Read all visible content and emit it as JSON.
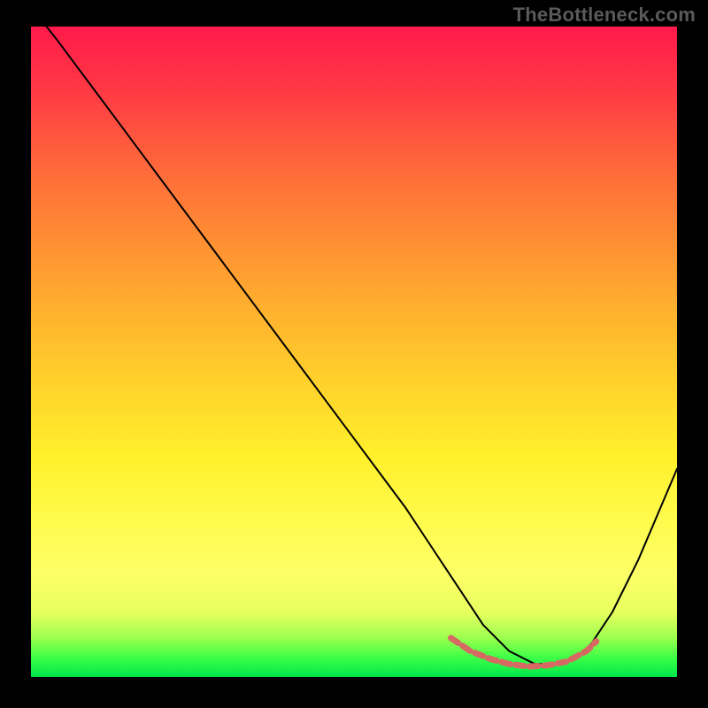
{
  "watermark": "TheBottleneck.com",
  "chart_data": {
    "type": "line",
    "title": "",
    "xlabel": "",
    "ylabel": "",
    "xlim": [
      0,
      100
    ],
    "ylim": [
      0,
      100
    ],
    "grid": false,
    "series": [
      {
        "name": "main-curve",
        "color": "#000000",
        "width": 2,
        "x": [
          0,
          4,
          10,
          16,
          22,
          28,
          34,
          40,
          46,
          52,
          58,
          62,
          66,
          70,
          74,
          78,
          82,
          86,
          90,
          94,
          100
        ],
        "y": [
          103,
          98,
          90,
          82,
          74,
          66,
          58,
          50,
          42,
          34,
          26,
          20,
          14,
          8,
          4,
          2,
          2,
          4,
          10,
          18,
          32
        ]
      },
      {
        "name": "highlight-segment",
        "color": "#d66a63",
        "width": 7,
        "x": [
          65,
          68,
          71,
          74,
          77,
          80,
          83,
          86,
          87.5
        ],
        "y": [
          6,
          4,
          2.8,
          2,
          1.6,
          1.8,
          2.4,
          4,
          5.5
        ]
      }
    ],
    "gradient": {
      "top_color": "#ff1a4a",
      "bottom_color": "#00e74a"
    }
  }
}
